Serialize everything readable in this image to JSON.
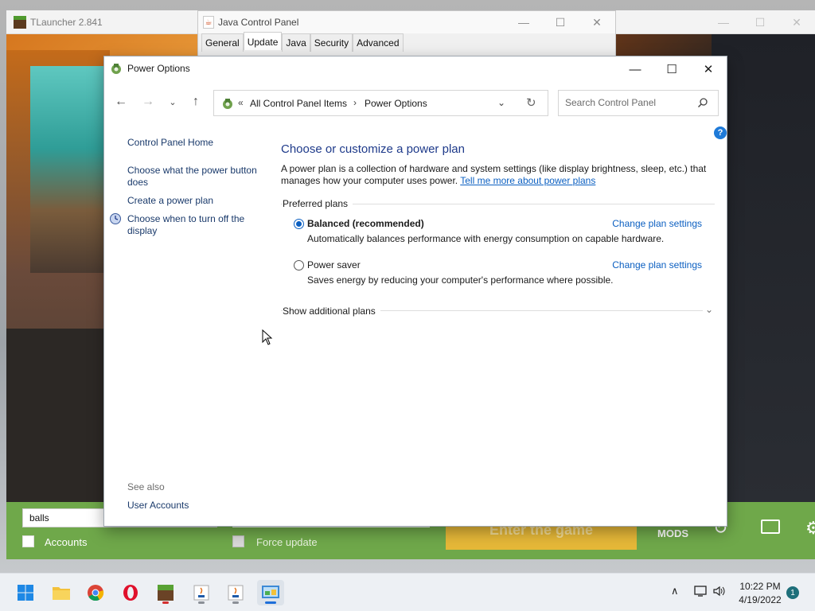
{
  "tlauncher": {
    "title": "TLauncher 2.841",
    "username_value": "balls",
    "accounts_label": "Accounts",
    "force_update_label": "Force update",
    "enter_game_label": "Enter the game",
    "mods_label": "MODS"
  },
  "java_panel": {
    "title": "Java Control Panel",
    "tabs": [
      {
        "label": "General"
      },
      {
        "label": "Update",
        "active": true
      },
      {
        "label": "Java"
      },
      {
        "label": "Security"
      },
      {
        "label": "Advanced"
      }
    ]
  },
  "power_options": {
    "title": "Power Options",
    "address": {
      "prefix": "«",
      "items": [
        "All Control Panel Items",
        "Power Options"
      ],
      "separator": "›"
    },
    "search": {
      "placeholder": "Search Control Panel"
    },
    "help_label": "?",
    "left_pane": {
      "home": "Control Panel Home",
      "links": [
        "Choose what the power button does",
        "Create a power plan",
        "Choose when to turn off the display"
      ],
      "see_also": "See also",
      "user_accounts": "User Accounts"
    },
    "main": {
      "heading": "Choose or customize a power plan",
      "description": "A power plan is a collection of hardware and system settings (like display brightness, sleep, etc.) that manages how your computer uses power.",
      "learn_more": "Tell me more about power plans",
      "preferred_label": "Preferred plans",
      "plans": [
        {
          "name": "Balanced (recommended)",
          "description": "Automatically balances performance with energy consumption on capable hardware.",
          "change_label": "Change plan settings",
          "selected": true
        },
        {
          "name": "Power saver",
          "description": "Saves energy by reducing your computer's performance where possible.",
          "change_label": "Change plan settings",
          "selected": false
        }
      ],
      "additional_label": "Show additional plans"
    }
  },
  "taskbar": {
    "apps": [
      "start-icon",
      "file-explorer-icon",
      "chrome-icon",
      "opera-icon",
      "tlauncher-icon",
      "java-icon",
      "java-icon-2",
      "control-panel-icon"
    ],
    "time": "10:22 PM",
    "date": "4/19/2022",
    "notification_count": "1"
  },
  "colors": {
    "accent": "#0b5fc1",
    "heading": "#1e3a8a",
    "tlauncher_green": "#6fa84a",
    "enter_button": "#e6b838"
  }
}
